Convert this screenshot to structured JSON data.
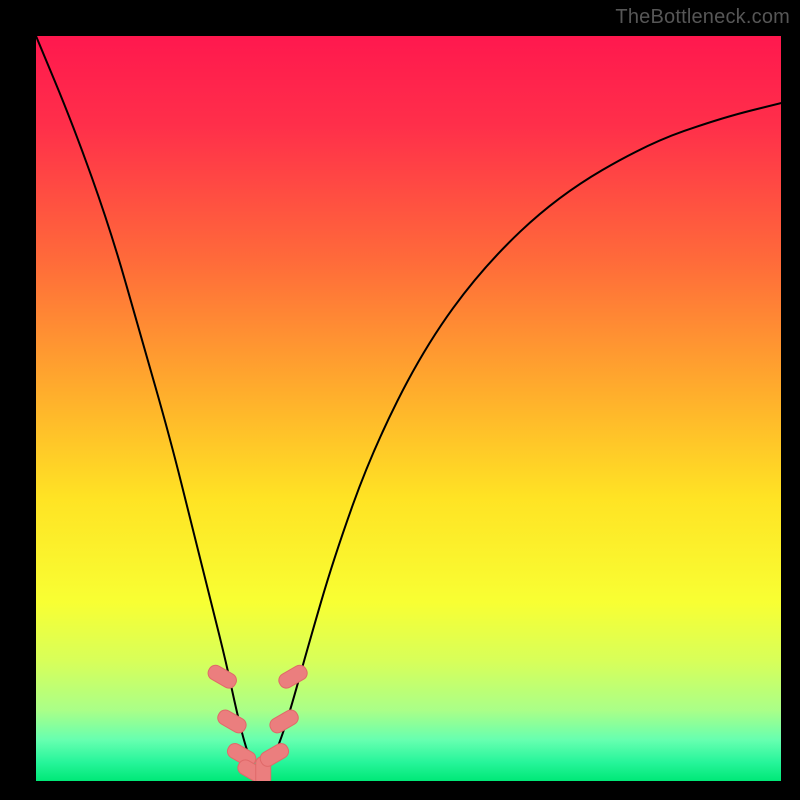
{
  "attribution": "TheBottleneck.com",
  "colors": {
    "frame": "#000000",
    "curve": "#000000",
    "marker_fill": "#eb7e7e",
    "marker_stroke": "#e06969",
    "gradient_stops": [
      {
        "offset": 0.0,
        "color": "#ff184e"
      },
      {
        "offset": 0.12,
        "color": "#ff2f4a"
      },
      {
        "offset": 0.3,
        "color": "#ff6a3a"
      },
      {
        "offset": 0.48,
        "color": "#ffae2c"
      },
      {
        "offset": 0.62,
        "color": "#ffe324"
      },
      {
        "offset": 0.76,
        "color": "#f8ff33"
      },
      {
        "offset": 0.84,
        "color": "#d7ff5a"
      },
      {
        "offset": 0.905,
        "color": "#aaff88"
      },
      {
        "offset": 0.945,
        "color": "#66ffb0"
      },
      {
        "offset": 0.975,
        "color": "#26f59a"
      },
      {
        "offset": 1.0,
        "color": "#00e877"
      }
    ]
  },
  "chart_data": {
    "type": "line",
    "title": "",
    "xlabel": "",
    "ylabel": "",
    "xlim": [
      0,
      100
    ],
    "ylim": [
      0,
      100
    ],
    "series": [
      {
        "name": "bottleneck-curve",
        "x": [
          0,
          5,
          10,
          14,
          18,
          21,
          23.5,
          25.5,
          27,
          28.3,
          29.5,
          30.8,
          32.3,
          34,
          36.5,
          40,
          45,
          52,
          60,
          70,
          82,
          92,
          100
        ],
        "y": [
          100,
          88,
          74,
          60,
          46,
          34,
          24,
          16,
          9,
          4,
          1.2,
          1.2,
          4,
          9,
          18,
          30,
          44,
          58,
          69,
          78.5,
          85.5,
          89,
          91
        ]
      }
    ],
    "markers": {
      "name": "highlight-beads",
      "x": [
        25.0,
        26.3,
        27.6,
        29.0,
        30.5,
        32.0,
        33.3,
        34.5
      ],
      "y": [
        14.0,
        8.0,
        3.5,
        1.3,
        1.3,
        3.5,
        8.0,
        14.0
      ]
    }
  }
}
